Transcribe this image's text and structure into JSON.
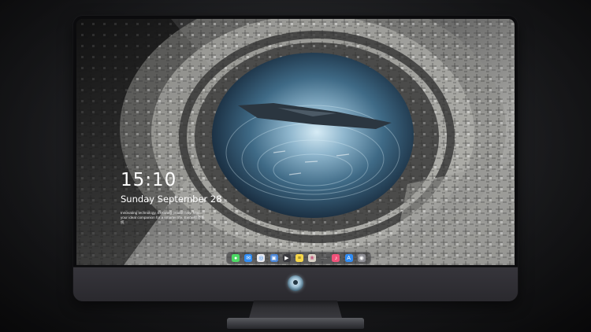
{
  "lock_screen": {
    "time": "15:10",
    "date": "Sunday September 28",
    "tagline": "Innovating technology, Ensuring productivity. Mac, your ideal companion for a smarter life. Ewow标签系统"
  },
  "dock": {
    "icons": [
      {
        "name": "messages-icon",
        "color": "#4cd964",
        "glyph": "●"
      },
      {
        "name": "mail-icon",
        "color": "#2f8cf5",
        "glyph": "✉"
      },
      {
        "name": "safari-icon",
        "color": "#e9e9ee",
        "glyph": "◎"
      },
      {
        "name": "preview-icon",
        "color": "#4a86d8",
        "glyph": "▣"
      },
      {
        "name": "clapper-icon",
        "color": "#3a3a3f",
        "glyph": "▶"
      },
      {
        "name": "notes-icon",
        "color": "#f7d74a",
        "glyph": "≡"
      },
      {
        "name": "photos-icon",
        "color": "#d9d2c6",
        "glyph": "❀"
      },
      {
        "name": "music-icon",
        "color": "#f0527a",
        "glyph": "♪"
      },
      {
        "name": "app-store-icon",
        "color": "#2f8cf5",
        "glyph": "A"
      },
      {
        "name": "camera-icon",
        "color": "#8d8d93",
        "glyph": "◉"
      }
    ]
  },
  "colors": {
    "accent": "#7eb4d3",
    "frame": "#0b0b0d",
    "chin": "#36353b"
  }
}
